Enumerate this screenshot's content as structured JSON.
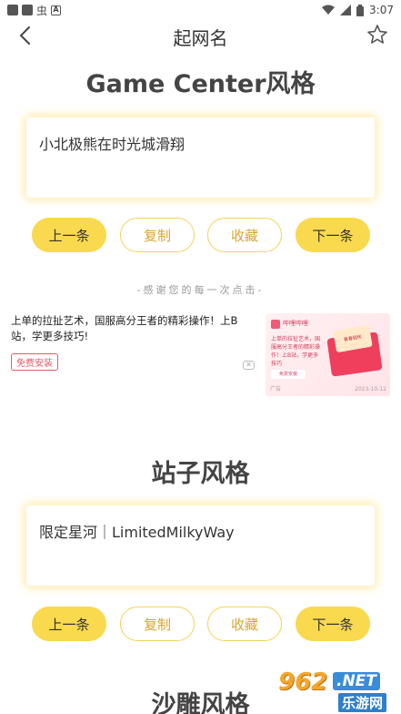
{
  "status": {
    "time": "3:07"
  },
  "nav": {
    "title": "起网名"
  },
  "sections": [
    {
      "title": "Game Center风格",
      "name": "小北极熊在时光城滑翔",
      "buttons": {
        "prev": "上一条",
        "copy": "复制",
        "favorite": "收藏",
        "next": "下一条"
      }
    },
    {
      "title": "站子风格",
      "name": "限定星河｜LimitedMilkyWay",
      "buttons": {
        "prev": "上一条",
        "copy": "复制",
        "favorite": "收藏",
        "next": "下一条"
      }
    },
    {
      "title": "沙雕风格"
    }
  ],
  "thanks": "-感谢您的每一次点击-",
  "ad": {
    "text": "上单的拉扯艺术，国服高分王者的精彩操作！上B站，学更多技巧!",
    "button": "免费安装",
    "close": "✕",
    "image": {
      "brand": "哔哩哔哩",
      "text": "上单的拉扯艺术，国服高分王者的精彩操作！上B站，学更多技巧",
      "button": "免费安装",
      "envelope": "青春相伴",
      "tag": "广告",
      "date": "2023-10-12"
    }
  },
  "watermark": {
    "num": "962",
    "net": ".NET",
    "site": "乐游网"
  },
  "colors": {
    "accent": "#f9d94e",
    "outline": "#f2d35a",
    "outline_text": "#d9a52c",
    "ad_red": "#e25a66"
  }
}
